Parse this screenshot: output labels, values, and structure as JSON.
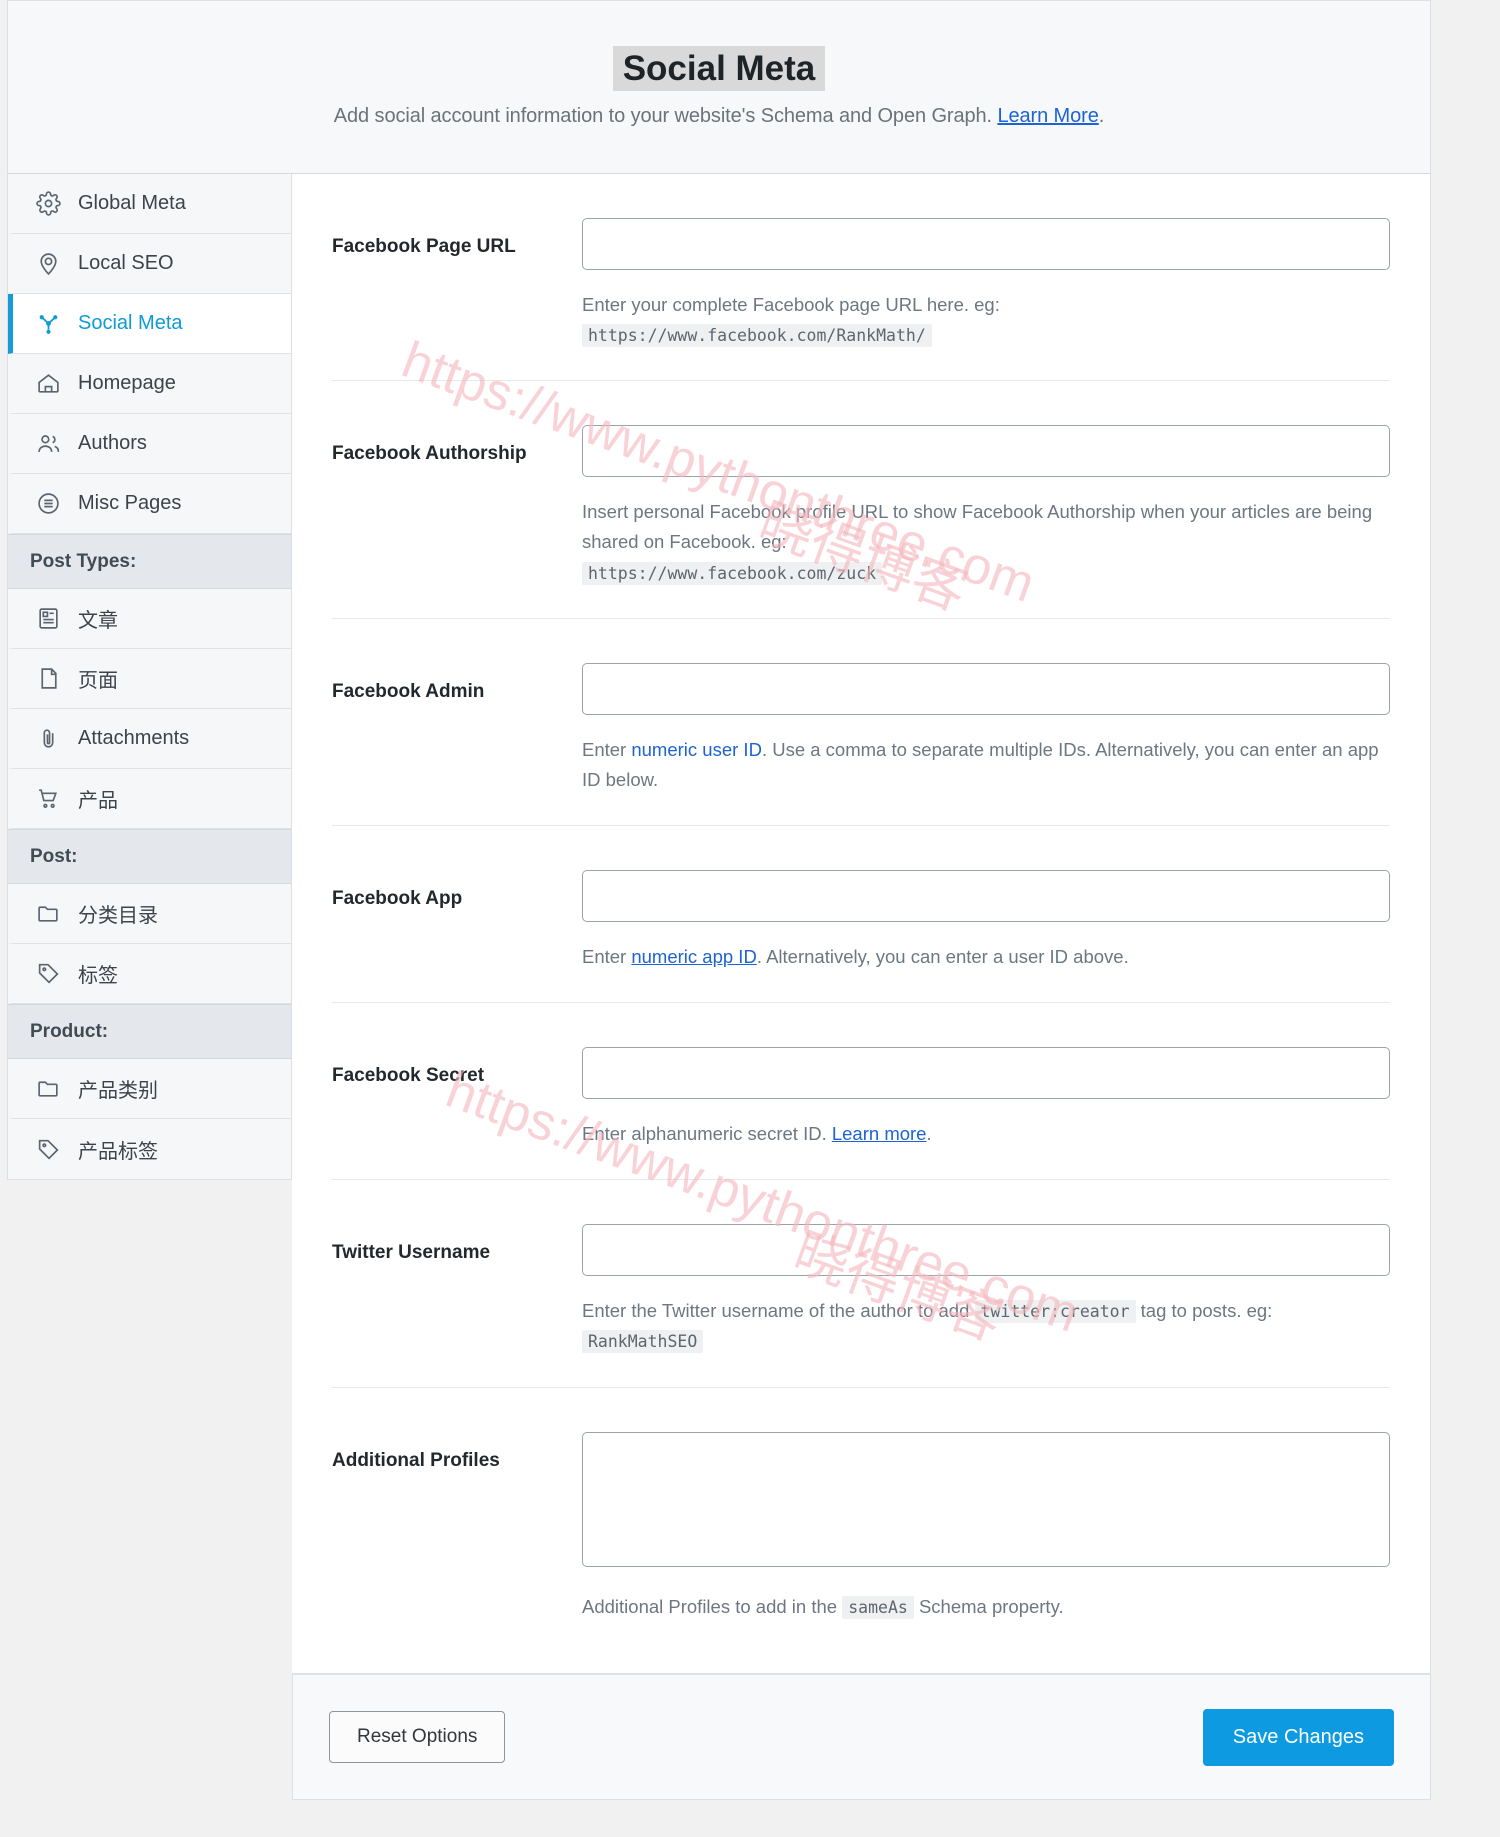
{
  "header": {
    "title": "Social Meta",
    "subtitle_before": "Add social account information to your website's Schema and Open Graph. ",
    "learn_more_label": "Learn More",
    "subtitle_after": "."
  },
  "sidebar": {
    "items": [
      {
        "label": "Global Meta",
        "icon": "gear-icon",
        "active": false
      },
      {
        "label": "Local SEO",
        "icon": "map-pin-icon",
        "active": false
      },
      {
        "label": "Social Meta",
        "icon": "share-nodes-icon",
        "active": true
      },
      {
        "label": "Homepage",
        "icon": "home-icon",
        "active": false
      },
      {
        "label": "Authors",
        "icon": "users-icon",
        "active": false
      },
      {
        "label": "Misc Pages",
        "icon": "list-circle-icon",
        "active": false
      }
    ],
    "section_post_types": "Post Types:",
    "post_type_items": [
      {
        "label": "文章",
        "icon": "article-icon"
      },
      {
        "label": "页面",
        "icon": "page-icon"
      },
      {
        "label": "Attachments",
        "icon": "paperclip-icon"
      },
      {
        "label": "产品",
        "icon": "cart-icon"
      }
    ],
    "section_post": "Post:",
    "post_items": [
      {
        "label": "分类目录",
        "icon": "folder-icon"
      },
      {
        "label": "标签",
        "icon": "tag-icon"
      }
    ],
    "section_product": "Product:",
    "product_items": [
      {
        "label": "产品类别",
        "icon": "folder-icon"
      },
      {
        "label": "产品标签",
        "icon": "tag-icon"
      }
    ]
  },
  "form": {
    "facebook_page_url": {
      "label": "Facebook Page URL",
      "value": "",
      "desc_text": "Enter your complete Facebook page URL here. eg:",
      "desc_code": "https://www.facebook.com/RankMath/"
    },
    "facebook_authorship": {
      "label": "Facebook Authorship",
      "value": "",
      "desc_text": "Insert personal Facebook profile URL to show Facebook Authorship when your articles are being shared on Facebook. eg:",
      "desc_code": "https://www.facebook.com/zuck"
    },
    "facebook_admin": {
      "label": "Facebook Admin",
      "value": "",
      "desc_before": "Enter ",
      "desc_link": "numeric user ID",
      "desc_after": ". Use a comma to separate multiple IDs. Alternatively, you can enter an app ID below."
    },
    "facebook_app": {
      "label": "Facebook App",
      "value": "",
      "desc_before": "Enter ",
      "desc_link": "numeric app ID",
      "desc_after": ". Alternatively, you can enter a user ID above."
    },
    "facebook_secret": {
      "label": "Facebook Secret",
      "value": "",
      "desc_before": "Enter alphanumeric secret ID. ",
      "desc_link": "Learn more",
      "desc_after": "."
    },
    "twitter_username": {
      "label": "Twitter Username",
      "value": "",
      "desc_before": "Enter the Twitter username of the author to add ",
      "desc_code1": "twitter:creator",
      "desc_middle": " tag to posts. eg: ",
      "desc_code2": "RankMathSEO"
    },
    "additional_profiles": {
      "label": "Additional Profiles",
      "value": "",
      "desc_before": "Additional Profiles to add in the ",
      "desc_code": "sameAs",
      "desc_after": " Schema property."
    }
  },
  "footer": {
    "reset_label": "Reset Options",
    "save_label": "Save Changes"
  },
  "watermark": {
    "url": "https://www.pythonthree.com",
    "cjk": "晓得博客"
  },
  "colors": {
    "accent": "#0d9ae0",
    "link": "#1c63d5",
    "active_nav": "#0f9ad6",
    "watermark": "#f4b8bd"
  }
}
